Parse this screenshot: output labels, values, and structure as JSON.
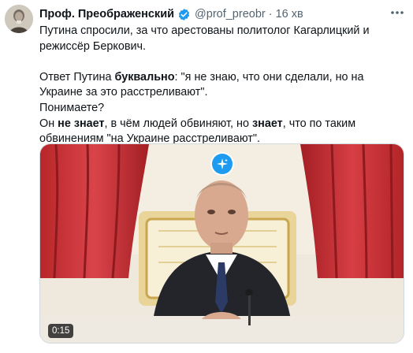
{
  "author": {
    "name": "Проф. Преображенский",
    "handle": "@prof_preobr",
    "separator": "·",
    "time": "16 хв",
    "avatar_icon": "avatar-portrait",
    "verified_icon": "verified-badge-icon"
  },
  "tweet": {
    "line1": "Путина спросили, за что арестованы политолог Кагарлицкий и режиссёр Беркович.",
    "p2_prefix": "Ответ Путина ",
    "p2_bold": "буквально",
    "p2_rest": ": \"я не знаю, что они сделали, но на Украине за это расстреливают\".",
    "p3": "Понимаете?",
    "p4_prefix": "Он ",
    "p4_bold1": "не знает",
    "p4_mid": ", в чём людей обвиняют, но ",
    "p4_bold2": "знает",
    "p4_rest": ", что по таким обвинениям \"на Украине расстреливают\"."
  },
  "media": {
    "duration": "0:15",
    "overlay_icon": "sparkle-icon"
  },
  "colors": {
    "accent": "#1d9bf0",
    "secondary_text": "#536471"
  }
}
